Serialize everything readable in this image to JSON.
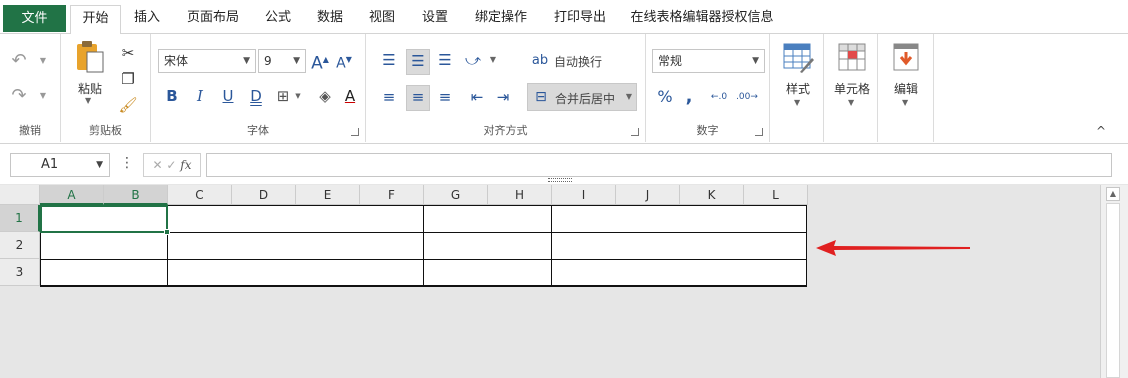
{
  "tabs": {
    "file": "文件",
    "home": "开始",
    "insert": "插入",
    "page_layout": "页面布局",
    "formulas": "公式",
    "data": "数据",
    "view": "视图",
    "settings": "设置",
    "bind_ops": "绑定操作",
    "print_export": "打印导出",
    "license_info": "在线表格编辑器授权信息"
  },
  "ribbon": {
    "undo_group": "撤销",
    "clipboard_group": "剪贴板",
    "paste_label": "粘贴",
    "font_group": "字体",
    "font_name": "宋体",
    "font_size": "9",
    "bold": "B",
    "italic": "I",
    "underline": "U",
    "double_underline": "D",
    "font_color_letter": "A",
    "increase_font": "A",
    "decrease_font": "A",
    "align_group": "对齐方式",
    "wrap_text": "自动换行",
    "merge_center": "合并后居中",
    "number_group": "数字",
    "number_format": "常规",
    "style_label": "样式",
    "cell_label": "单元格",
    "edit_label": "编辑",
    "collapse_icon": "^"
  },
  "formula_bar": {
    "name_box": "A1",
    "fx": "fx",
    "cancel": "✕",
    "confirm": "✓",
    "more": "⋮",
    "value": ""
  },
  "grid": {
    "columns": [
      "A",
      "B",
      "C",
      "D",
      "E",
      "F",
      "G",
      "H",
      "I",
      "J",
      "K",
      "L"
    ],
    "rows": [
      "1",
      "2",
      "3"
    ],
    "active_cell": "A1"
  },
  "colors": {
    "accent": "#217346",
    "arrow": "#e02020"
  }
}
